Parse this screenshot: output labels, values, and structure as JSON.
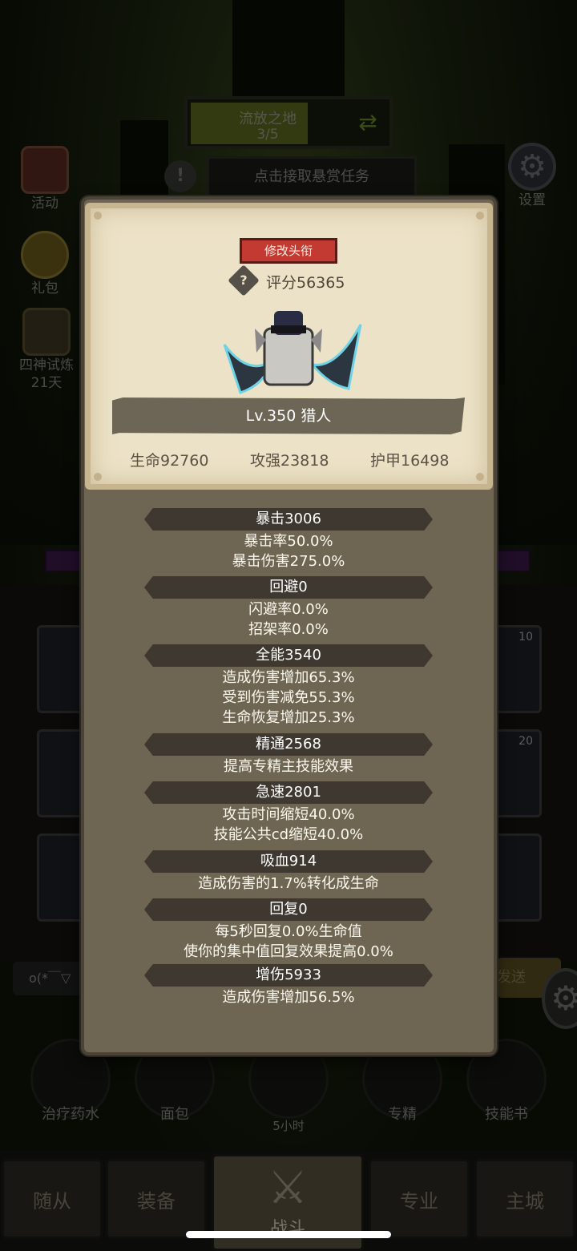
{
  "stage": {
    "name": "流放之地",
    "progress": "3/5",
    "progress_fraction": 0.6
  },
  "bounty": {
    "label": "点击接取悬赏任务"
  },
  "side_left": [
    {
      "label": "活动"
    },
    {
      "label": "礼包"
    },
    {
      "label": "四神试炼",
      "sub": "21天"
    }
  ],
  "side_right": {
    "settings_label": "设置"
  },
  "chat": {
    "placeholder": "o(*￣▽",
    "send_label": "发送"
  },
  "skill_slots": {
    "right_top_count": "10",
    "right_mid_count": "20"
  },
  "items": [
    {
      "label": "治疗药水"
    },
    {
      "label": "面包"
    },
    {
      "label": "专精"
    },
    {
      "label": "技能书"
    }
  ],
  "chest_timer": "5小时",
  "nav": [
    {
      "label": "随从"
    },
    {
      "label": "装备"
    },
    {
      "label": "战斗"
    },
    {
      "label": "专业"
    },
    {
      "label": "主城"
    }
  ],
  "card": {
    "change_title_label": "修改头衔",
    "rating": "评分56365",
    "level_class": "Lv.350 猎人",
    "hp": "生命92760",
    "atk": "攻强23818",
    "armor": "护甲16498"
  },
  "attributes": [
    {
      "head": "暴击3006",
      "subs": [
        "暴击率50.0%",
        "暴击伤害275.0%"
      ]
    },
    {
      "head": "回避0",
      "subs": [
        "闪避率0.0%",
        "招架率0.0%"
      ]
    },
    {
      "head": "全能3540",
      "subs": [
        "造成伤害增加65.3%",
        "受到伤害减免55.3%",
        "生命恢复增加25.3%"
      ]
    },
    {
      "head": "精通2568",
      "subs": [
        "提高专精主技能效果"
      ]
    },
    {
      "head": "急速2801",
      "subs": [
        "攻击时间缩短40.0%",
        "技能公共cd缩短40.0%"
      ]
    },
    {
      "head": "吸血914",
      "subs": [
        "造成伤害的1.7%转化成生命"
      ]
    },
    {
      "head": "回复0",
      "subs": [
        "每5秒回复0.0%生命值",
        "使你的集中值回复效果提高0.0%"
      ]
    },
    {
      "head": "增伤5933",
      "subs": [
        "造成伤害增加56.5%"
      ]
    }
  ]
}
